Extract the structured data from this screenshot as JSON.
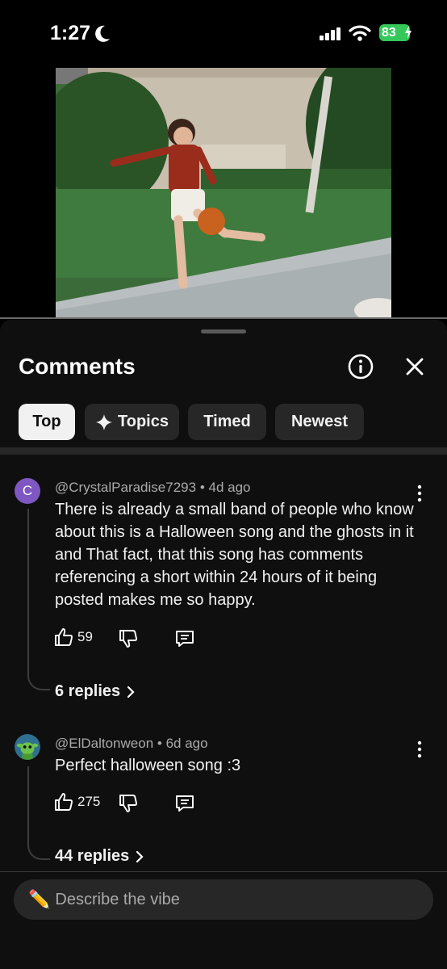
{
  "status_bar": {
    "time": "1:27",
    "battery": "83"
  },
  "sheet": {
    "title": "Comments",
    "chips": [
      {
        "label": "Top",
        "active": true
      },
      {
        "label": "Topics",
        "active": false
      },
      {
        "label": "Timed",
        "active": false
      },
      {
        "label": "Newest",
        "active": false
      }
    ]
  },
  "comments": [
    {
      "avatar_letter": "C",
      "handle": "@CrystalParadise7293",
      "age": "4d ago",
      "text": "There is already a small band of people who know about this is a Halloween song and the ghosts in it and That fact, that this song has comments referencing a short within 24 hours of it being posted makes me so happy.",
      "likes": "59",
      "replies": "6 replies"
    },
    {
      "handle": "@ElDaltonweon",
      "age": "6d ago",
      "text": "Perfect halloween song :3",
      "likes": "275",
      "replies": "44 replies"
    }
  ],
  "composer": {
    "placeholder": "Describe the vibe",
    "pencil": "✏️"
  },
  "colors": {
    "background": "#0f0f0f",
    "chip": "#272727",
    "chip_active": "#f1f1f1",
    "battery": "#34c759",
    "avatar_c": "#7e57c2"
  },
  "icons": [
    "moon-icon",
    "signal-icon",
    "wifi-icon",
    "info-icon",
    "close-icon",
    "sparkle-icon",
    "like-icon",
    "dislike-icon",
    "reply-icon",
    "kebab-icon",
    "chevron-right-icon"
  ]
}
